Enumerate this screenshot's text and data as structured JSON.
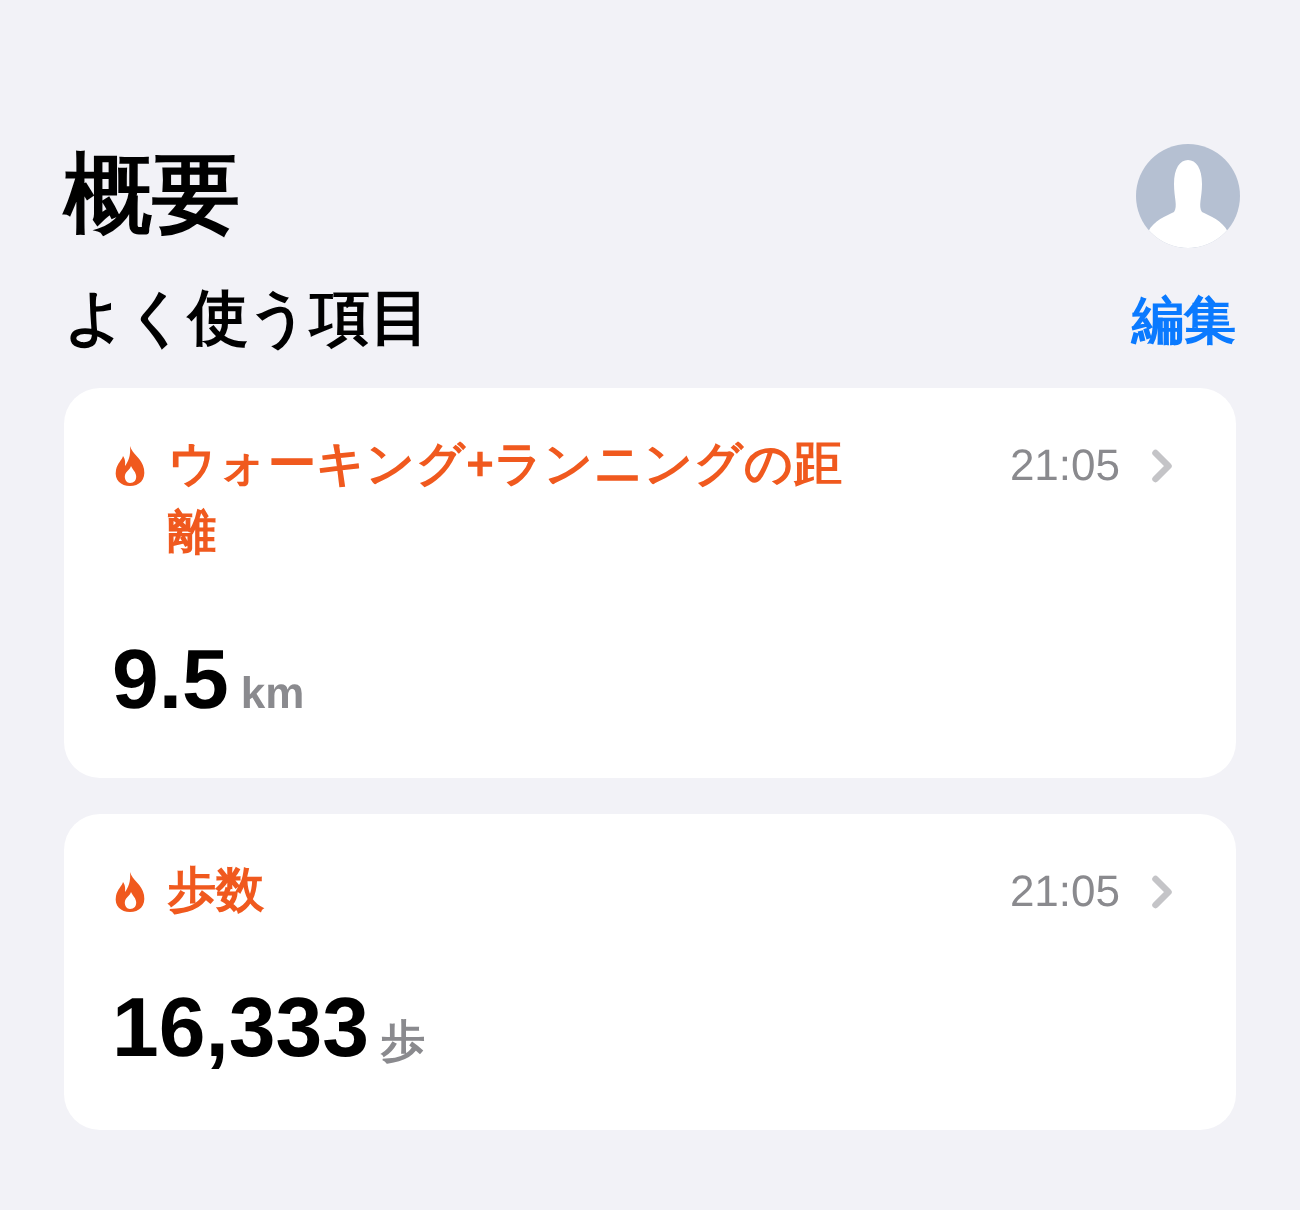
{
  "header": {
    "title": "概要"
  },
  "favorites": {
    "title": "よく使う項目",
    "edit": "編集"
  },
  "cards": [
    {
      "title": "ウォーキング+ランニングの距離",
      "time": "21:05",
      "value": "9.5",
      "unit": "km"
    },
    {
      "title": "歩数",
      "time": "21:05",
      "value": "16,333",
      "unit": "歩"
    }
  ]
}
